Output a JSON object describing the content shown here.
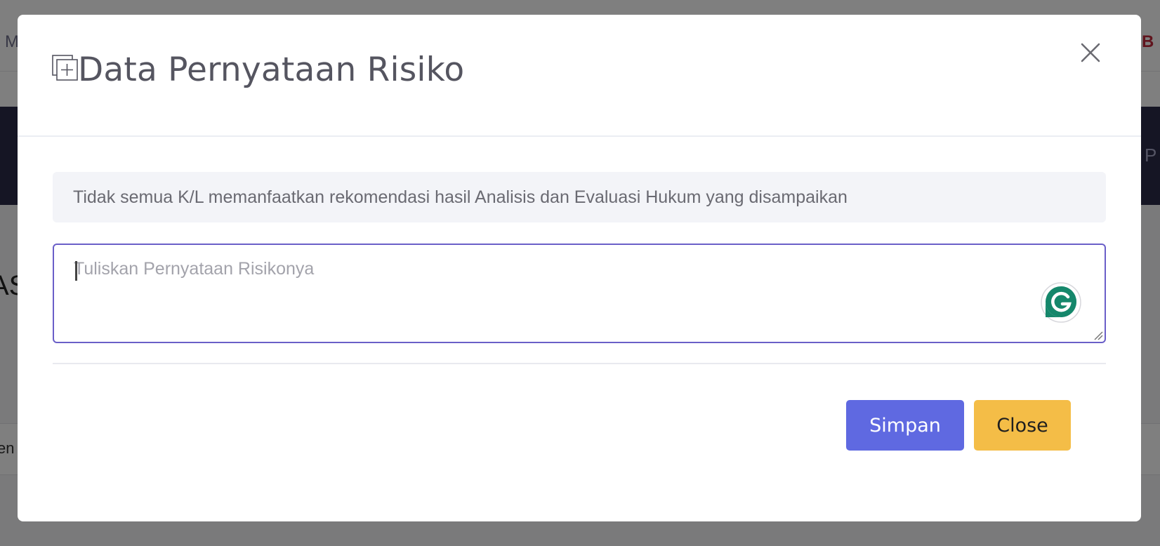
{
  "background": {
    "fragment_left_top": "M",
    "fragment_right_top": "B",
    "fragment_right_nav": "P",
    "fragment_left_heading": "AS",
    "fragment_left_row": "en"
  },
  "modal": {
    "title": "Data Pernyataan Risiko",
    "title_icon": "add-box-icon",
    "close_icon": "close-icon",
    "statement_text": "Tidak semua K/L memanfaatkan rekomendasi hasil Analisis dan Evaluasi Hukum yang disampaikan",
    "input": {
      "placeholder": "Tuliskan Pernyataan Risikonya",
      "value": ""
    },
    "grammarly_icon": "grammarly-icon",
    "buttons": {
      "save_label": "Simpan",
      "close_label": "Close"
    }
  },
  "colors": {
    "primary": "#5f69e1",
    "warning": "#f4bd47",
    "focus_border": "#6a5fc8",
    "grammarly": "#15876b"
  }
}
